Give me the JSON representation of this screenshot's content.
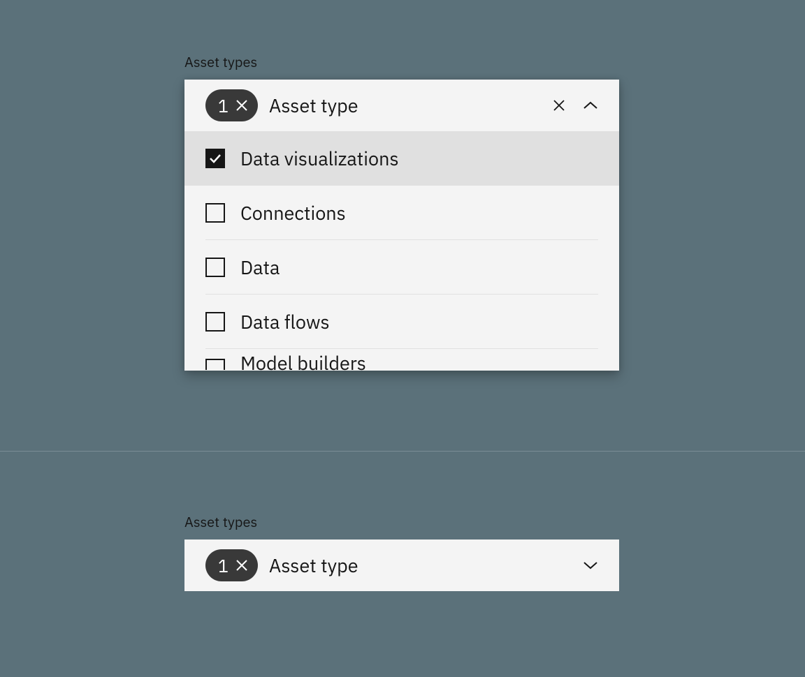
{
  "section1": {
    "label": "Asset types",
    "pill_count": "1",
    "dropdown_label": "Asset type",
    "items": [
      {
        "label": "Data visualizations",
        "checked": true
      },
      {
        "label": "Connections",
        "checked": false
      },
      {
        "label": "Data",
        "checked": false
      },
      {
        "label": "Data flows",
        "checked": false
      },
      {
        "label": "Model builders",
        "checked": false
      }
    ]
  },
  "section2": {
    "label": "Asset types",
    "pill_count": "1",
    "dropdown_label": "Asset type"
  }
}
